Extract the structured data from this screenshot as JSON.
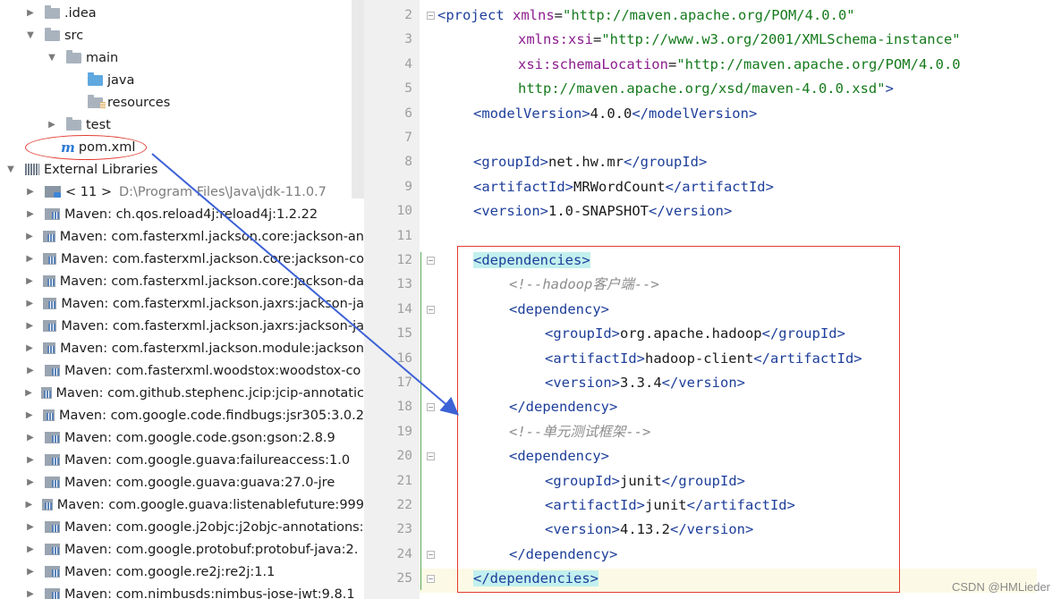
{
  "tree": {
    "items": [
      {
        "arrow": "▶",
        "icon": "folder-icon",
        "label": ".idea"
      },
      {
        "arrow": "▼",
        "icon": "folder-icon",
        "label": "src"
      },
      {
        "arrow": "▼",
        "icon": "folder-icon",
        "label": "main"
      },
      {
        "arrow": "",
        "icon": "source-folder-icon",
        "label": "java"
      },
      {
        "arrow": "",
        "icon": "resources-folder-icon",
        "label": "resources"
      },
      {
        "arrow": "▶",
        "icon": "folder-icon",
        "label": "test"
      },
      {
        "arrow": "",
        "icon": "maven-file-icon",
        "label": "pom.xml"
      },
      {
        "arrow": "▼",
        "icon": "libraries-icon",
        "label": "External Libraries"
      },
      {
        "arrow": "▶",
        "icon": "jdk-icon",
        "label": "< 11 >",
        "note": "D:\\Program Files\\Java\\jdk-11.0.7"
      },
      {
        "arrow": "▶",
        "icon": "library-icon",
        "label": "Maven: ch.qos.reload4j:reload4j:1.2.22"
      },
      {
        "arrow": "▶",
        "icon": "library-icon",
        "label": "Maven: com.fasterxml.jackson.core:jackson-an"
      },
      {
        "arrow": "▶",
        "icon": "library-icon",
        "label": "Maven: com.fasterxml.jackson.core:jackson-co"
      },
      {
        "arrow": "▶",
        "icon": "library-icon",
        "label": "Maven: com.fasterxml.jackson.core:jackson-da"
      },
      {
        "arrow": "▶",
        "icon": "library-icon",
        "label": "Maven: com.fasterxml.jackson.jaxrs:jackson-ja"
      },
      {
        "arrow": "▶",
        "icon": "library-icon",
        "label": "Maven: com.fasterxml.jackson.jaxrs:jackson-ja"
      },
      {
        "arrow": "▶",
        "icon": "library-icon",
        "label": "Maven: com.fasterxml.jackson.module:jackson"
      },
      {
        "arrow": "▶",
        "icon": "library-icon",
        "label": "Maven: com.fasterxml.woodstox:woodstox-co"
      },
      {
        "arrow": "▶",
        "icon": "library-icon",
        "label": "Maven: com.github.stephenc.jcip:jcip-annotatic"
      },
      {
        "arrow": "▶",
        "icon": "library-icon",
        "label": "Maven: com.google.code.findbugs:jsr305:3.0.2"
      },
      {
        "arrow": "▶",
        "icon": "library-icon",
        "label": "Maven: com.google.code.gson:gson:2.8.9"
      },
      {
        "arrow": "▶",
        "icon": "library-icon",
        "label": "Maven: com.google.guava:failureaccess:1.0"
      },
      {
        "arrow": "▶",
        "icon": "library-icon",
        "label": "Maven: com.google.guava:guava:27.0-jre"
      },
      {
        "arrow": "▶",
        "icon": "library-icon",
        "label": "Maven: com.google.guava:listenablefuture:999"
      },
      {
        "arrow": "▶",
        "icon": "library-icon",
        "label": "Maven: com.google.j2objc:j2objc-annotations:"
      },
      {
        "arrow": "▶",
        "icon": "library-icon",
        "label": "Maven: com.google.protobuf:protobuf-java:2."
      },
      {
        "arrow": "▶",
        "icon": "library-icon",
        "label": "Maven: com.google.re2j:re2j:1.1"
      },
      {
        "arrow": "▶",
        "icon": "library-icon",
        "label": "Maven: com.nimbusds:nimbus-jose-jwt:9.8.1"
      }
    ]
  },
  "editor": {
    "lines": [
      {
        "num": "2",
        "segments": [
          [
            "tg",
            "<project "
          ],
          [
            "at",
            "xmlns"
          ],
          [
            "tx",
            "="
          ],
          [
            "av",
            "\"http://maven.apache.org/POM/4.0.0\""
          ]
        ]
      },
      {
        "num": "3",
        "segments": [
          [
            "at",
            "xmlns:"
          ],
          [
            "at",
            "xsi"
          ],
          [
            "tx",
            "="
          ],
          [
            "av",
            "\"http://www.w3.org/2001/XMLSchema-instance\""
          ]
        ]
      },
      {
        "num": "4",
        "segments": [
          [
            "at",
            "xsi:schemaLocation"
          ],
          [
            "tx",
            "="
          ],
          [
            "av",
            "\"http://maven.apache.org/POM/4.0.0"
          ]
        ]
      },
      {
        "num": "5",
        "segments": [
          [
            "av",
            "http://maven.apache.org/xsd/maven-4.0.0.xsd\""
          ],
          [
            "tg",
            ">"
          ]
        ]
      },
      {
        "num": "6",
        "segments": [
          [
            "tg",
            "<modelVersion>"
          ],
          [
            "tx",
            "4.0.0"
          ],
          [
            "tg",
            "</modelVersion>"
          ]
        ]
      },
      {
        "num": "7",
        "segments": []
      },
      {
        "num": "8",
        "segments": [
          [
            "tg",
            "<groupId>"
          ],
          [
            "tx",
            "net.hw.mr"
          ],
          [
            "tg",
            "</groupId>"
          ]
        ]
      },
      {
        "num": "9",
        "segments": [
          [
            "tg",
            "<artifactId>"
          ],
          [
            "tx",
            "MRWordCount"
          ],
          [
            "tg",
            "</artifactId>"
          ]
        ]
      },
      {
        "num": "10",
        "segments": [
          [
            "tg",
            "<version>"
          ],
          [
            "tx",
            "1.0-SNAPSHOT"
          ],
          [
            "tg",
            "</version>"
          ]
        ]
      },
      {
        "num": "11",
        "segments": []
      },
      {
        "num": "12",
        "segments": [
          [
            "tg hl",
            "<dependencies>"
          ]
        ]
      },
      {
        "num": "13",
        "segments": [
          [
            "cm",
            "<!--hadoop客户端-->"
          ]
        ]
      },
      {
        "num": "14",
        "segments": [
          [
            "tg",
            "<dependency>"
          ]
        ]
      },
      {
        "num": "15",
        "segments": [
          [
            "tg",
            "<groupId>"
          ],
          [
            "tx",
            "org.apache.hadoop"
          ],
          [
            "tg",
            "</groupId>"
          ]
        ]
      },
      {
        "num": "16",
        "segments": [
          [
            "tg",
            "<artifactId>"
          ],
          [
            "tx",
            "hadoop-client"
          ],
          [
            "tg",
            "</artifactId>"
          ]
        ]
      },
      {
        "num": "17",
        "segments": [
          [
            "tg",
            "<version>"
          ],
          [
            "tx",
            "3.3.4"
          ],
          [
            "tg",
            "</version>"
          ]
        ]
      },
      {
        "num": "18",
        "segments": [
          [
            "tg",
            "</dependency>"
          ]
        ]
      },
      {
        "num": "19",
        "segments": [
          [
            "cm",
            "<!--单元测试框架-->"
          ]
        ]
      },
      {
        "num": "20",
        "segments": [
          [
            "tg",
            "<dependency>"
          ]
        ]
      },
      {
        "num": "21",
        "segments": [
          [
            "tg",
            "<groupId>"
          ],
          [
            "tx",
            "junit"
          ],
          [
            "tg",
            "</groupId>"
          ]
        ]
      },
      {
        "num": "22",
        "segments": [
          [
            "tg",
            "<artifactId>"
          ],
          [
            "tx",
            "junit"
          ],
          [
            "tg",
            "</artifactId>"
          ]
        ]
      },
      {
        "num": "23",
        "segments": [
          [
            "tg",
            "<version>"
          ],
          [
            "tx",
            "4.13.2"
          ],
          [
            "tg",
            "</version>"
          ]
        ]
      },
      {
        "num": "24",
        "segments": [
          [
            "tg",
            "</dependency>"
          ]
        ]
      },
      {
        "num": "25",
        "segments": [
          [
            "tg hl",
            "</dependencies>"
          ]
        ]
      }
    ]
  },
  "watermark": "CSDN @HMLieder",
  "colors": {
    "annotation": "#e23b32",
    "arrow": "#3d62d6",
    "tag": "#1d3e9a",
    "attribute": "#8c1c8e",
    "string": "#157a1c",
    "comment": "#8c8c8c"
  }
}
